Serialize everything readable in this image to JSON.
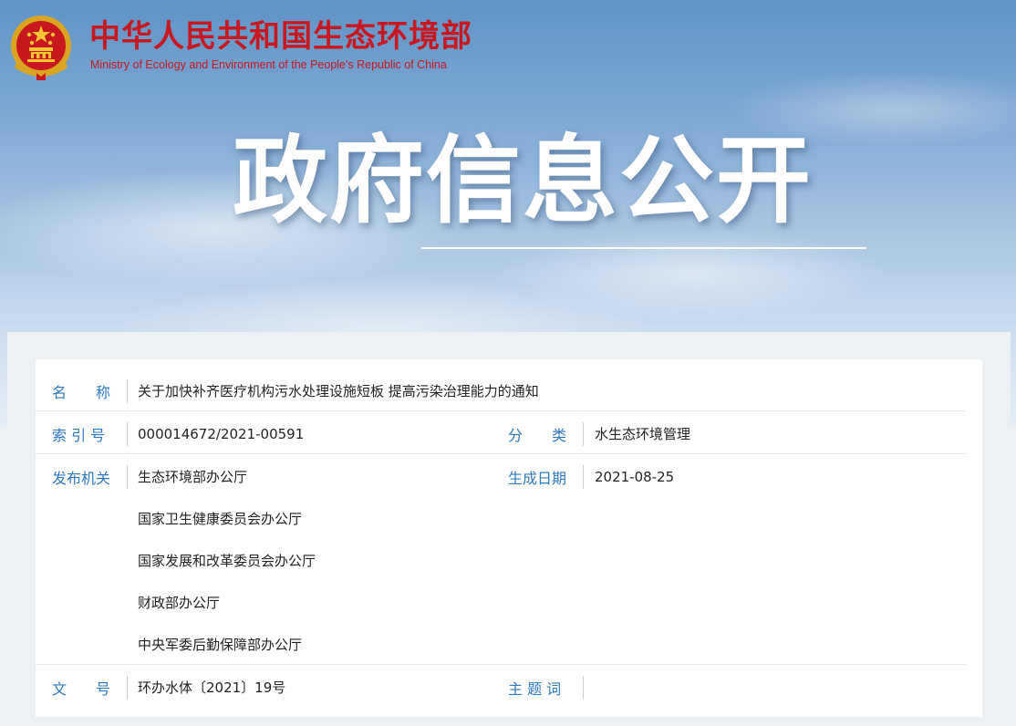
{
  "header": {
    "title_cn": "中华人民共和国生态环境部",
    "title_en": "Ministry of Ecology and Environment of the People's Republic of China",
    "emblem_icon": "national-emblem-icon",
    "brand_color": "#c8171e"
  },
  "banner": {
    "title": "政府信息公开"
  },
  "info": {
    "name_label": "名　　称",
    "name_value": "关于加快补齐医疗机构污水处理设施短板 提高污染治理能力的通知",
    "index_label": "索 引 号",
    "index_value": "000014672/2021-00591",
    "category_label": "分　　类",
    "category_value": "水生态环境管理",
    "issuer_label": "发布机关",
    "issuers": [
      "生态环境部办公厅",
      "国家卫生健康委员会办公厅",
      "国家发展和改革委员会办公厅",
      "财政部办公厅",
      "中央军委后勤保障部办公厅"
    ],
    "date_label": "生成日期",
    "date_value": "2021-08-25",
    "doc_no_label": "文　　号",
    "doc_no_value": "环办水体〔2021〕19号",
    "subject_label": "主 题 词",
    "subject_value": "",
    "label_color": "#2f79bd"
  }
}
